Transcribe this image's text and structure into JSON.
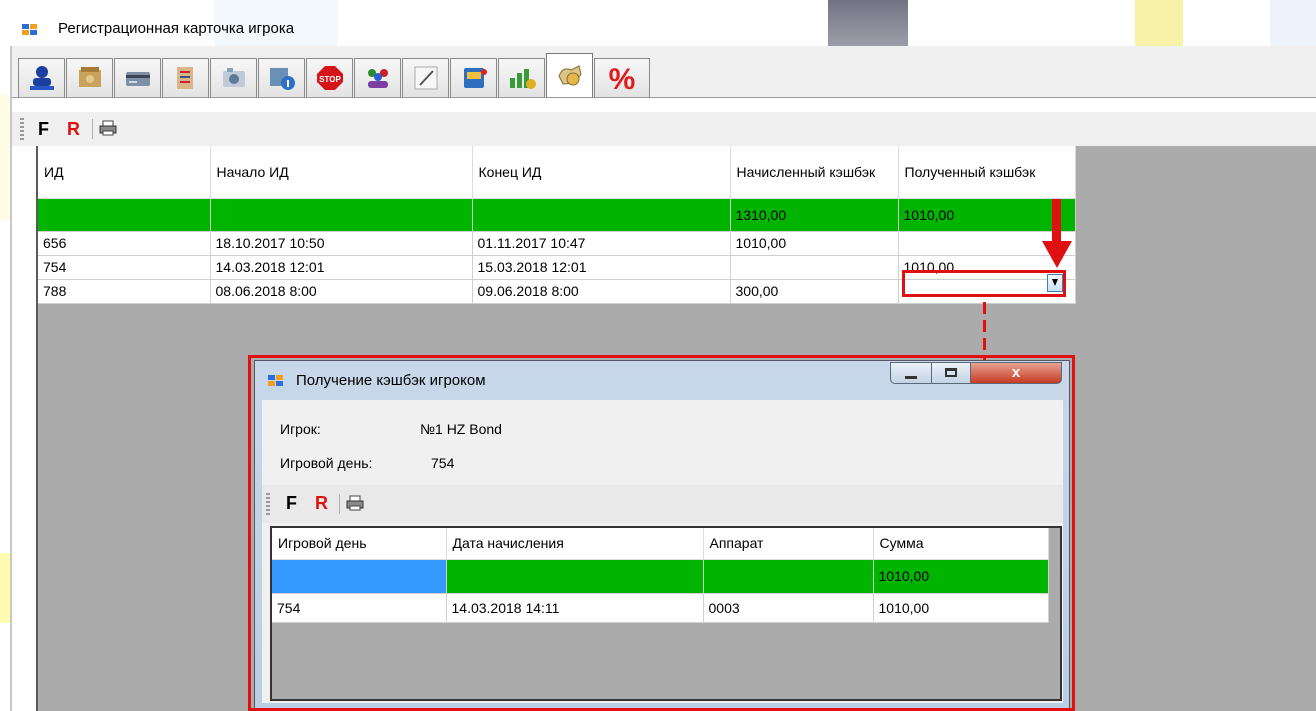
{
  "window": {
    "title": "Регистрационная карточка игрока"
  },
  "tabs": [
    {
      "icon": "player-stamp-icon"
    },
    {
      "icon": "wallet-icon"
    },
    {
      "icon": "card-icon"
    },
    {
      "icon": "notes-icon"
    },
    {
      "icon": "photo-icon"
    },
    {
      "icon": "calendar-info-icon"
    },
    {
      "icon": "stop-icon",
      "text": "STOP"
    },
    {
      "icon": "group-icon"
    },
    {
      "icon": "pen-icon"
    },
    {
      "icon": "slot-machine-icon"
    },
    {
      "icon": "chart-money-icon"
    },
    {
      "icon": "cashback-coins-icon",
      "active": true
    },
    {
      "icon": "percent-icon",
      "text": "%"
    }
  ],
  "toolbar": {
    "f_label": "F",
    "r_label": "R"
  },
  "main_grid": {
    "columns": [
      "ИД",
      "Начало ИД",
      "Конец ИД",
      "Начисленный кэшбэк",
      "Полученный кэшбэк"
    ],
    "total_row": [
      "",
      "",
      "",
      "1310,00",
      "1010,00"
    ],
    "rows": [
      [
        "656",
        "18.10.2017 10:50",
        "01.11.2017 10:47",
        "1010,00",
        ""
      ],
      [
        "754",
        "14.03.2018 12:01",
        "15.03.2018 12:01",
        "",
        "1010,00"
      ],
      [
        "788",
        "08.06.2018 8:00",
        "09.06.2018 8:00",
        "300,00",
        ""
      ]
    ]
  },
  "dialog": {
    "title": "Получение кэшбэк игроком",
    "close_label": "x",
    "player_label": "Игрок:",
    "player_value": "№1 HZ Bond",
    "day_label": "Игровой день:",
    "day_value": "754",
    "toolbar": {
      "f_label": "F",
      "r_label": "R"
    },
    "grid": {
      "columns": [
        "Игровой день",
        "Дата начисления",
        "Аппарат",
        "Сумма"
      ],
      "total_row": [
        "",
        "",
        "",
        "1010,00"
      ],
      "rows": [
        [
          "754",
          "14.03.2018 14:11",
          "0003",
          "1010,00"
        ]
      ]
    }
  },
  "colors": {
    "total_row": "#00b400",
    "selected_cell": "#3399ff",
    "highlight": "#e01010"
  }
}
